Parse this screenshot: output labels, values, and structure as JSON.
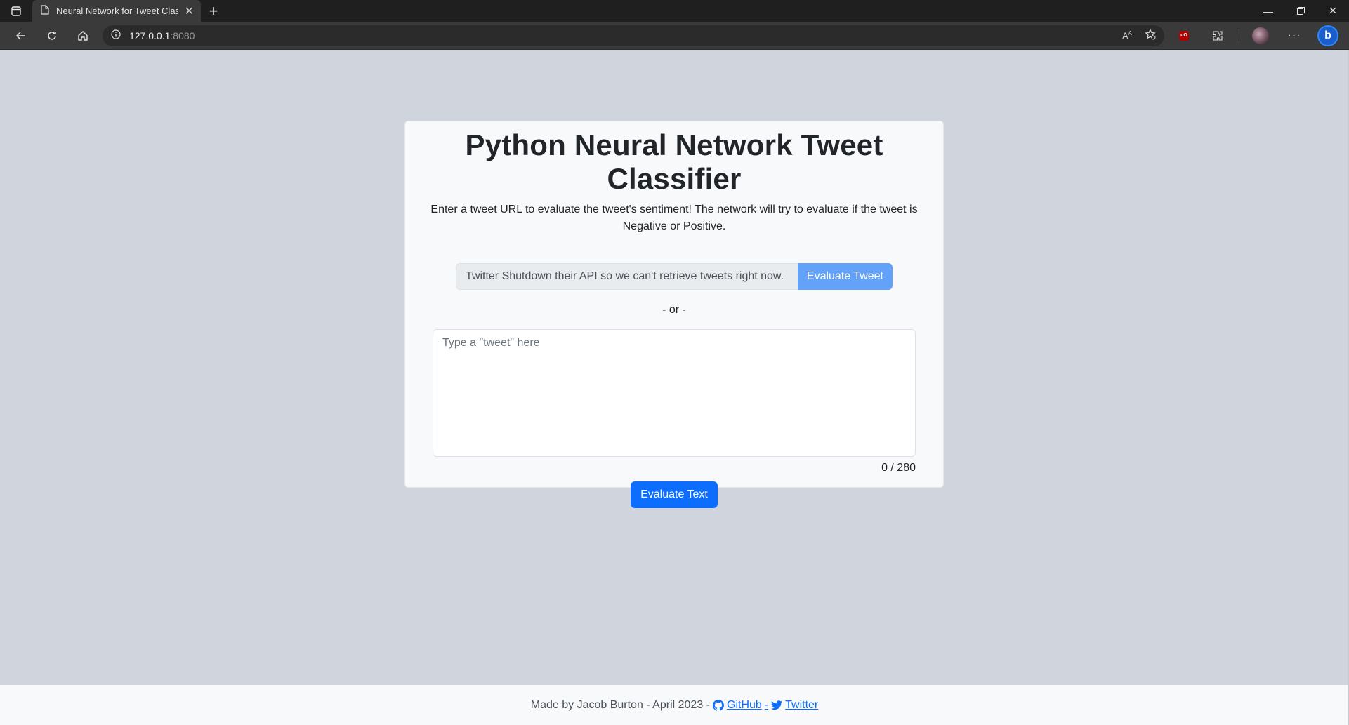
{
  "browser": {
    "tab_title": "Neural Network for Tweet Classifier",
    "url_host": "127.0.0.1",
    "url_port": ":8080"
  },
  "page": {
    "title": "Python Neural Network Tweet Classifier",
    "subtitle": "Enter a tweet URL to evaluate the tweet's sentiment! The network will try to evaluate if the tweet is Negative or Positive.",
    "url_input_value": "Twitter Shutdown their API so we can't retrieve tweets right now.",
    "evaluate_tweet_label": "Evaluate Tweet",
    "or_separator": "- or -",
    "textarea_placeholder": "Type a \"tweet\" here",
    "char_count": "0 / 280",
    "evaluate_text_label": "Evaluate Text"
  },
  "footer": {
    "made_by": "Made by Jacob Burton - April 2023 -",
    "github_label": "GitHub",
    "dash": "-",
    "twitter_label": "Twitter"
  },
  "colors": {
    "page_bg": "#d0d4dc",
    "card_bg": "#f8f9fa",
    "primary": "#0d6efd",
    "primary_disabled": "#62a2f8"
  }
}
